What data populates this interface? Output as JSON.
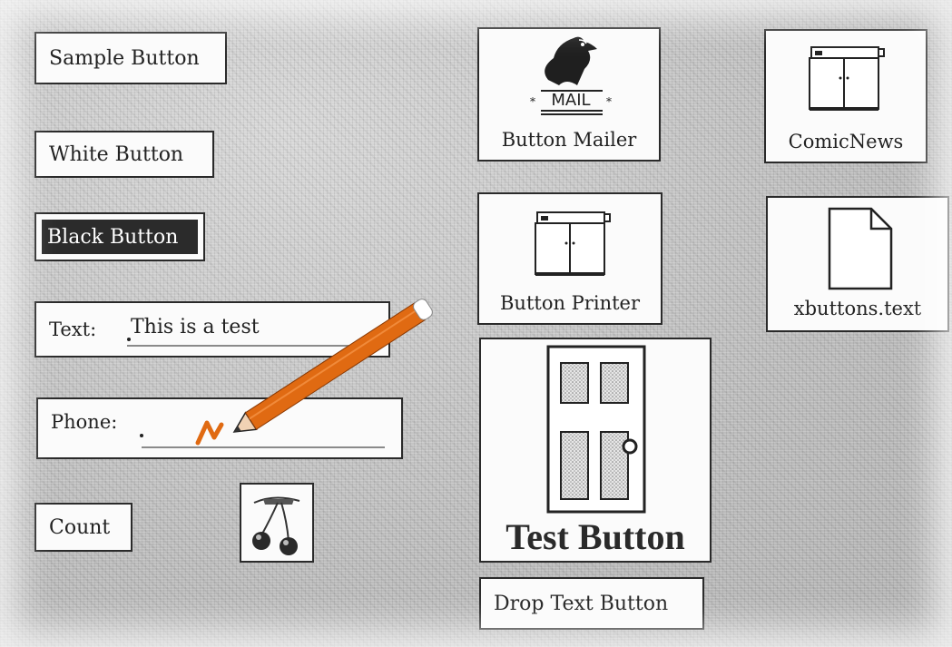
{
  "buttons": {
    "sample": "Sample Button",
    "white": "White Button",
    "black": "Black Button",
    "count": "Count",
    "mailer": "Button Mailer",
    "mail_sign": "MAIL",
    "comic_news": "ComicNews",
    "printer": "Button Printer",
    "file": "xbuttons.text",
    "test": "Test Button",
    "drop_text": "Drop Text Button"
  },
  "fields": {
    "text_label": "Text:",
    "text_value": "This is a test",
    "phone_label": "Phone:",
    "phone_value": ""
  },
  "icons": {
    "mailer": "eagle-mailbox-icon",
    "comic_news": "cabinet-icon",
    "printer": "printer-icon",
    "file": "document-icon",
    "door": "door-icon",
    "cherries": "cherries-icon",
    "pencil": "pencil-cursor-icon"
  },
  "colors": {
    "pencil": "#e06a12",
    "black_button": "#2b2b2b"
  }
}
